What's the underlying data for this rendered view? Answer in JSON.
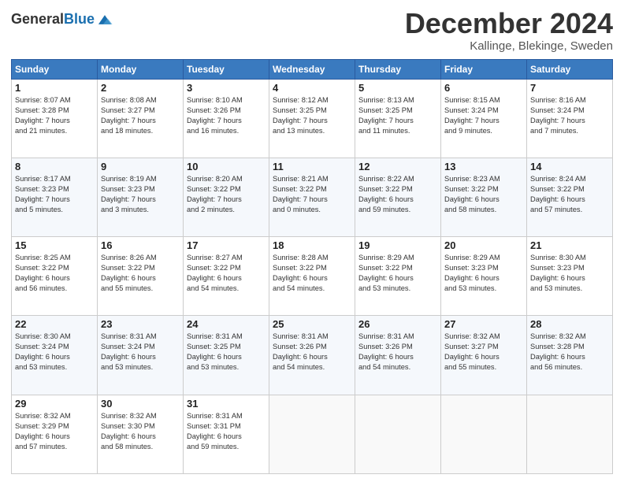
{
  "header": {
    "logo_general": "General",
    "logo_blue": "Blue",
    "main_title": "December 2024",
    "subtitle": "Kallinge, Blekinge, Sweden"
  },
  "calendar": {
    "days_of_week": [
      "Sunday",
      "Monday",
      "Tuesday",
      "Wednesday",
      "Thursday",
      "Friday",
      "Saturday"
    ],
    "weeks": [
      [
        {
          "day": "1",
          "sunrise": "Sunrise: 8:07 AM",
          "sunset": "Sunset: 3:28 PM",
          "daylight": "Daylight: 7 hours",
          "minutes": "and 21 minutes."
        },
        {
          "day": "2",
          "sunrise": "Sunrise: 8:08 AM",
          "sunset": "Sunset: 3:27 PM",
          "daylight": "Daylight: 7 hours",
          "minutes": "and 18 minutes."
        },
        {
          "day": "3",
          "sunrise": "Sunrise: 8:10 AM",
          "sunset": "Sunset: 3:26 PM",
          "daylight": "Daylight: 7 hours",
          "minutes": "and 16 minutes."
        },
        {
          "day": "4",
          "sunrise": "Sunrise: 8:12 AM",
          "sunset": "Sunset: 3:25 PM",
          "daylight": "Daylight: 7 hours",
          "minutes": "and 13 minutes."
        },
        {
          "day": "5",
          "sunrise": "Sunrise: 8:13 AM",
          "sunset": "Sunset: 3:25 PM",
          "daylight": "Daylight: 7 hours",
          "minutes": "and 11 minutes."
        },
        {
          "day": "6",
          "sunrise": "Sunrise: 8:15 AM",
          "sunset": "Sunset: 3:24 PM",
          "daylight": "Daylight: 7 hours",
          "minutes": "and 9 minutes."
        },
        {
          "day": "7",
          "sunrise": "Sunrise: 8:16 AM",
          "sunset": "Sunset: 3:24 PM",
          "daylight": "Daylight: 7 hours",
          "minutes": "and 7 minutes."
        }
      ],
      [
        {
          "day": "8",
          "sunrise": "Sunrise: 8:17 AM",
          "sunset": "Sunset: 3:23 PM",
          "daylight": "Daylight: 7 hours",
          "minutes": "and 5 minutes."
        },
        {
          "day": "9",
          "sunrise": "Sunrise: 8:19 AM",
          "sunset": "Sunset: 3:23 PM",
          "daylight": "Daylight: 7 hours",
          "minutes": "and 3 minutes."
        },
        {
          "day": "10",
          "sunrise": "Sunrise: 8:20 AM",
          "sunset": "Sunset: 3:22 PM",
          "daylight": "Daylight: 7 hours",
          "minutes": "and 2 minutes."
        },
        {
          "day": "11",
          "sunrise": "Sunrise: 8:21 AM",
          "sunset": "Sunset: 3:22 PM",
          "daylight": "Daylight: 7 hours",
          "minutes": "and 0 minutes."
        },
        {
          "day": "12",
          "sunrise": "Sunrise: 8:22 AM",
          "sunset": "Sunset: 3:22 PM",
          "daylight": "Daylight: 6 hours",
          "minutes": "and 59 minutes."
        },
        {
          "day": "13",
          "sunrise": "Sunrise: 8:23 AM",
          "sunset": "Sunset: 3:22 PM",
          "daylight": "Daylight: 6 hours",
          "minutes": "and 58 minutes."
        },
        {
          "day": "14",
          "sunrise": "Sunrise: 8:24 AM",
          "sunset": "Sunset: 3:22 PM",
          "daylight": "Daylight: 6 hours",
          "minutes": "and 57 minutes."
        }
      ],
      [
        {
          "day": "15",
          "sunrise": "Sunrise: 8:25 AM",
          "sunset": "Sunset: 3:22 PM",
          "daylight": "Daylight: 6 hours",
          "minutes": "and 56 minutes."
        },
        {
          "day": "16",
          "sunrise": "Sunrise: 8:26 AM",
          "sunset": "Sunset: 3:22 PM",
          "daylight": "Daylight: 6 hours",
          "minutes": "and 55 minutes."
        },
        {
          "day": "17",
          "sunrise": "Sunrise: 8:27 AM",
          "sunset": "Sunset: 3:22 PM",
          "daylight": "Daylight: 6 hours",
          "minutes": "and 54 minutes."
        },
        {
          "day": "18",
          "sunrise": "Sunrise: 8:28 AM",
          "sunset": "Sunset: 3:22 PM",
          "daylight": "Daylight: 6 hours",
          "minutes": "and 54 minutes."
        },
        {
          "day": "19",
          "sunrise": "Sunrise: 8:29 AM",
          "sunset": "Sunset: 3:22 PM",
          "daylight": "Daylight: 6 hours",
          "minutes": "and 53 minutes."
        },
        {
          "day": "20",
          "sunrise": "Sunrise: 8:29 AM",
          "sunset": "Sunset: 3:23 PM",
          "daylight": "Daylight: 6 hours",
          "minutes": "and 53 minutes."
        },
        {
          "day": "21",
          "sunrise": "Sunrise: 8:30 AM",
          "sunset": "Sunset: 3:23 PM",
          "daylight": "Daylight: 6 hours",
          "minutes": "and 53 minutes."
        }
      ],
      [
        {
          "day": "22",
          "sunrise": "Sunrise: 8:30 AM",
          "sunset": "Sunset: 3:24 PM",
          "daylight": "Daylight: 6 hours",
          "minutes": "and 53 minutes."
        },
        {
          "day": "23",
          "sunrise": "Sunrise: 8:31 AM",
          "sunset": "Sunset: 3:24 PM",
          "daylight": "Daylight: 6 hours",
          "minutes": "and 53 minutes."
        },
        {
          "day": "24",
          "sunrise": "Sunrise: 8:31 AM",
          "sunset": "Sunset: 3:25 PM",
          "daylight": "Daylight: 6 hours",
          "minutes": "and 53 minutes."
        },
        {
          "day": "25",
          "sunrise": "Sunrise: 8:31 AM",
          "sunset": "Sunset: 3:26 PM",
          "daylight": "Daylight: 6 hours",
          "minutes": "and 54 minutes."
        },
        {
          "day": "26",
          "sunrise": "Sunrise: 8:31 AM",
          "sunset": "Sunset: 3:26 PM",
          "daylight": "Daylight: 6 hours",
          "minutes": "and 54 minutes."
        },
        {
          "day": "27",
          "sunrise": "Sunrise: 8:32 AM",
          "sunset": "Sunset: 3:27 PM",
          "daylight": "Daylight: 6 hours",
          "minutes": "and 55 minutes."
        },
        {
          "day": "28",
          "sunrise": "Sunrise: 8:32 AM",
          "sunset": "Sunset: 3:28 PM",
          "daylight": "Daylight: 6 hours",
          "minutes": "and 56 minutes."
        }
      ],
      [
        {
          "day": "29",
          "sunrise": "Sunrise: 8:32 AM",
          "sunset": "Sunset: 3:29 PM",
          "daylight": "Daylight: 6 hours",
          "minutes": "and 57 minutes."
        },
        {
          "day": "30",
          "sunrise": "Sunrise: 8:32 AM",
          "sunset": "Sunset: 3:30 PM",
          "daylight": "Daylight: 6 hours",
          "minutes": "and 58 minutes."
        },
        {
          "day": "31",
          "sunrise": "Sunrise: 8:31 AM",
          "sunset": "Sunset: 3:31 PM",
          "daylight": "Daylight: 6 hours",
          "minutes": "and 59 minutes."
        },
        null,
        null,
        null,
        null
      ]
    ]
  }
}
